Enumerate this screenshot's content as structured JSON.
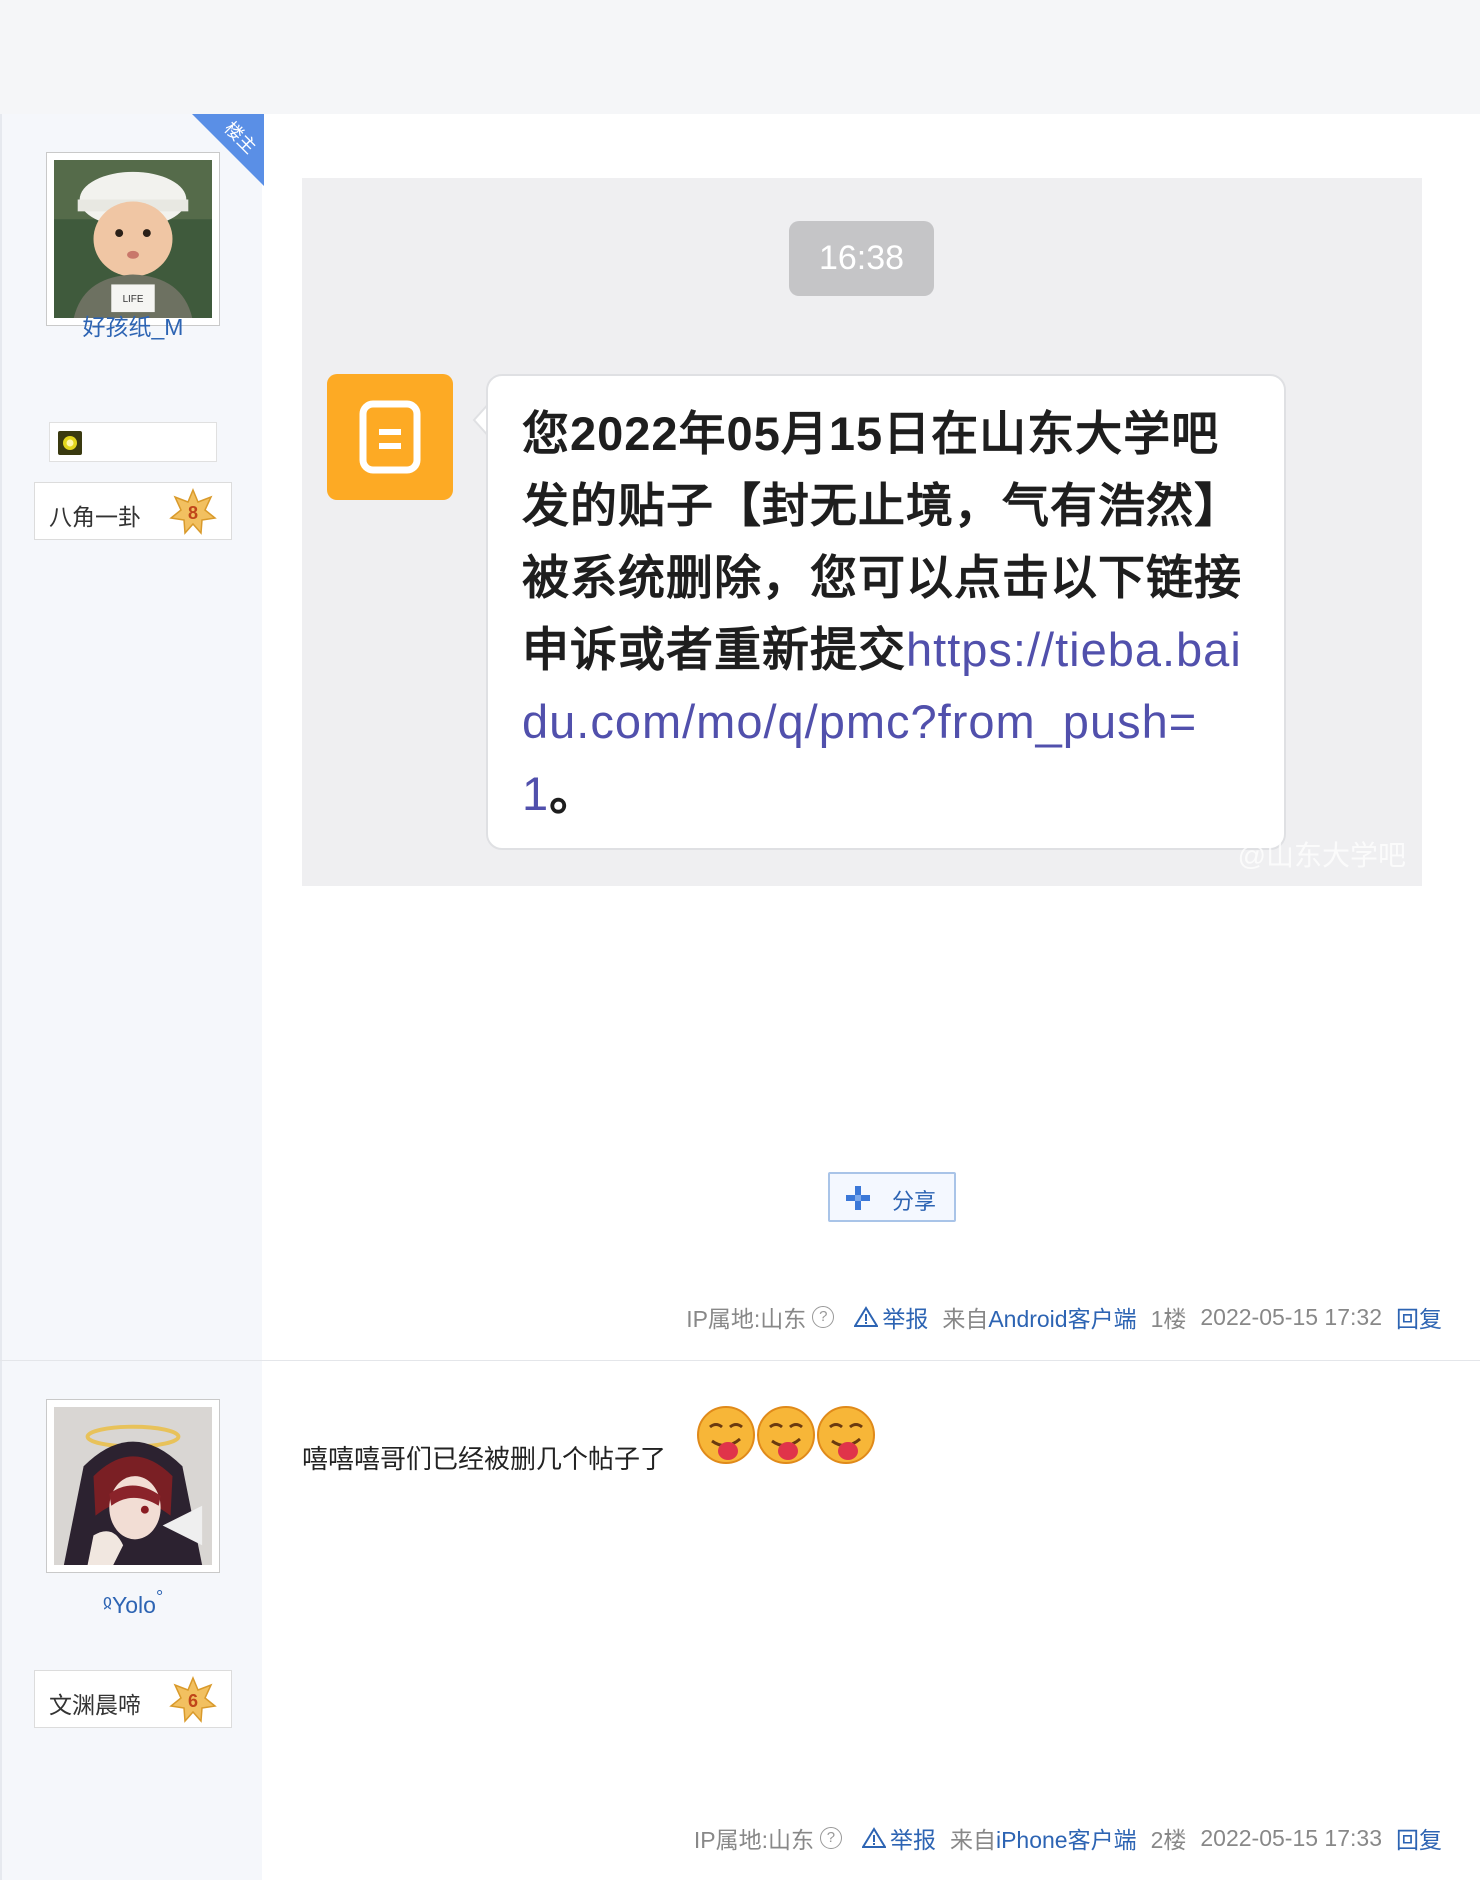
{
  "colors": {
    "link": "#2d64b3",
    "badge_orange": "#fdaa24",
    "corner_blue": "#5a8fe6"
  },
  "posts": [
    {
      "author": {
        "name": "好孩纸_M",
        "avatar_icon": "avatar-child-photo",
        "corner_badge": "楼主",
        "level_title": "八角一卦",
        "level": "8"
      },
      "image": {
        "time": "16:38",
        "message_prefix": "您2022年05月15日在山东大学吧发的贴子【封无止境，气有浩然】被系统删除，您可以点击以下链接申诉或者重新提交",
        "message_link": "https://tieba.baidu.com/mo/q/pmc?from_push=1",
        "message_suffix": "。",
        "watermark": "@山东大学吧"
      },
      "share_label": "分享",
      "footer": {
        "ip": "IP属地:山东",
        "help_icon": "?",
        "report": "举报",
        "from_prefix": "来自",
        "client": "Android客户端",
        "floor": "1楼",
        "time": "2022-05-15 17:32",
        "reply": "回复"
      }
    },
    {
      "author": {
        "name_prefix": "ჲ",
        "name": "Yolo",
        "name_suffix": "°",
        "avatar_icon": "avatar-anime-portrait",
        "level_title": "文渊晨啼",
        "level": "6"
      },
      "text": "嘻嘻嘻哥们已经被删几个帖子了",
      "emoji_count": 3,
      "footer": {
        "ip": "IP属地:山东",
        "help_icon": "?",
        "report": "举报",
        "from_prefix": "来自",
        "client": "iPhone客户端",
        "floor": "2楼",
        "time": "2022-05-15 17:33",
        "reply": "回复"
      }
    }
  ]
}
